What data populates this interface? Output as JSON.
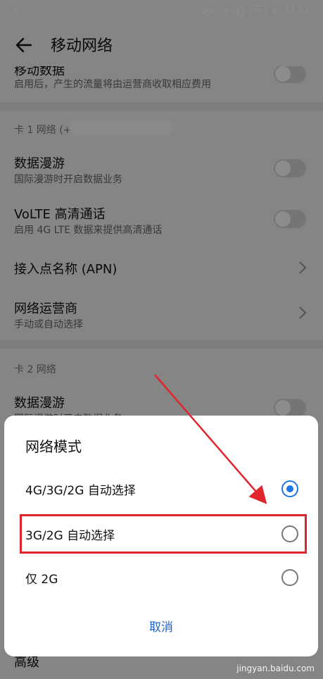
{
  "status_bar": {
    "left": "⁴⁶ᴵ ⁴⁶ᴵ",
    "battery": "84",
    "time": "12:55"
  },
  "header": {
    "title": "移动网络"
  },
  "rows": {
    "mobile_data": {
      "title": "移动数据",
      "subtitle": "启用后，产生的流量将由运营商收取相应费用"
    },
    "card1": {
      "section": "卡 1 网络 (+"
    },
    "roaming1": {
      "title": "数据漫游",
      "subtitle": "国际漫游时开启数据业务"
    },
    "volte": {
      "title": "VoLTE 高清通话",
      "subtitle": "启用 4G LTE 数据来提供高清通话"
    },
    "apn": {
      "title": "接入点名称 (APN)"
    },
    "operator": {
      "title": "网络运营商",
      "subtitle": "手动或自动选择"
    },
    "card2": {
      "section": "卡 2 网络"
    },
    "roaming2": {
      "title": "数据漫游",
      "subtitle": "国际漫游时开启数据业务"
    },
    "advanced": {
      "title": "高级"
    }
  },
  "dialog": {
    "title": "网络模式",
    "options": [
      {
        "label": "4G/3G/2G 自动选择",
        "selected": true
      },
      {
        "label": "3G/2G 自动选择",
        "selected": false
      },
      {
        "label": "仅 2G",
        "selected": false
      }
    ],
    "cancel": "取消"
  },
  "watermark": "jingyan.baidu.com",
  "colors": {
    "accent": "#1f75e8",
    "annotation": "#e0262c"
  }
}
